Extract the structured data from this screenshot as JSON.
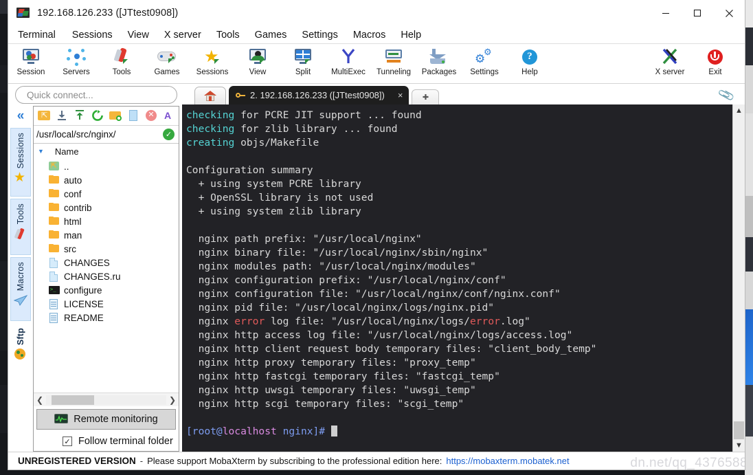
{
  "window": {
    "title": "192.168.126.233 ([JTtest0908])",
    "app_icon": "mobaxterm-icon",
    "controls": {
      "minimize": "minimize-icon",
      "maximize": "maximize-icon",
      "close": "close-icon"
    }
  },
  "menubar": {
    "items": [
      {
        "label": "Terminal"
      },
      {
        "label": "Sessions"
      },
      {
        "label": "View"
      },
      {
        "label": "X server"
      },
      {
        "label": "Tools"
      },
      {
        "label": "Games"
      },
      {
        "label": "Settings"
      },
      {
        "label": "Macros"
      },
      {
        "label": "Help"
      }
    ]
  },
  "toolbar": {
    "left_items": [
      {
        "label": "Session",
        "icon": "session-icon"
      },
      {
        "label": "Servers",
        "icon": "servers-icon"
      },
      {
        "label": "Tools",
        "icon": "tools-icon"
      },
      {
        "label": "Games",
        "icon": "games-icon"
      },
      {
        "label": "Sessions",
        "icon": "sessions-star-icon"
      },
      {
        "label": "View",
        "icon": "view-icon"
      },
      {
        "label": "Split",
        "icon": "split-icon"
      },
      {
        "label": "MultiExec",
        "icon": "multiexec-icon"
      },
      {
        "label": "Tunneling",
        "icon": "tunneling-icon"
      },
      {
        "label": "Packages",
        "icon": "packages-icon"
      },
      {
        "label": "Settings",
        "icon": "settings-gear-icon"
      },
      {
        "label": "Help",
        "icon": "help-icon"
      }
    ],
    "right_items": [
      {
        "label": "X server",
        "icon": "x-server-icon"
      },
      {
        "label": "Exit",
        "icon": "exit-power-icon"
      }
    ]
  },
  "sidebar": {
    "quick_connect_placeholder": "Quick connect...",
    "collapse_icon": "double-chevron-left-icon",
    "rail_tabs": [
      {
        "label": "Sessions",
        "icon": "star-icon",
        "selected": false
      },
      {
        "label": "Tools",
        "icon": "knife-icon",
        "selected": false
      },
      {
        "label": "Macros",
        "icon": "paperplane-icon",
        "selected": false
      },
      {
        "label": "Sftp",
        "icon": "globe-icon",
        "selected": true
      }
    ],
    "sftp_toolbar_icons": [
      "go-up-icon",
      "download-icon",
      "upload-icon",
      "refresh-icon",
      "new-folder-icon",
      "new-file-icon",
      "delete-icon",
      "edit-icon"
    ],
    "path": "/usr/local/src/nginx/",
    "path_ok_icon": "check-circle-icon",
    "column_header": "Name",
    "sort_caret_icon": "caret-down-icon",
    "files": [
      {
        "name": "..",
        "type": "parent"
      },
      {
        "name": "auto",
        "type": "folder"
      },
      {
        "name": "conf",
        "type": "folder"
      },
      {
        "name": "contrib",
        "type": "folder"
      },
      {
        "name": "html",
        "type": "folder"
      },
      {
        "name": "man",
        "type": "folder"
      },
      {
        "name": "src",
        "type": "folder"
      },
      {
        "name": "CHANGES",
        "type": "file"
      },
      {
        "name": "CHANGES.ru",
        "type": "file"
      },
      {
        "name": "configure",
        "type": "script"
      },
      {
        "name": "LICENSE",
        "type": "doc"
      },
      {
        "name": "README",
        "type": "doc"
      }
    ],
    "hscroll": {
      "left_arrow": "chevron-left-icon",
      "right_arrow": "chevron-right-icon"
    },
    "remote_monitoring_label": "Remote monitoring",
    "remote_monitoring_icon": "monitor-graph-icon",
    "follow_terminal_folder_label": "Follow terminal folder",
    "follow_terminal_folder_checked": true,
    "checkmark": "✓"
  },
  "tabs": {
    "home_icon": "home-icon",
    "terminal_tab": {
      "icon": "key-icon",
      "label": "2. 192.168.126.233 ([JTtest0908])",
      "close": "×"
    },
    "add_tab_label": "✚",
    "clip_icon": "paperclip-icon"
  },
  "terminal": {
    "prompt_user": "[root@",
    "prompt_host": "localhost",
    "prompt_path": " nginx]#",
    "lines": [
      {
        "segments": [
          {
            "t": "checking",
            "c": "cy"
          },
          {
            "t": " for PCRE JIT support ... found",
            "c": ""
          }
        ]
      },
      {
        "segments": [
          {
            "t": "checking",
            "c": "cy"
          },
          {
            "t": " for zlib library ... found",
            "c": ""
          }
        ]
      },
      {
        "segments": [
          {
            "t": "creating",
            "c": "cy"
          },
          {
            "t": " objs/Makefile",
            "c": ""
          }
        ]
      },
      {
        "segments": [
          {
            "t": "",
            "c": ""
          }
        ]
      },
      {
        "segments": [
          {
            "t": "Configuration summary",
            "c": ""
          }
        ]
      },
      {
        "segments": [
          {
            "t": "  + using system PCRE library",
            "c": ""
          }
        ]
      },
      {
        "segments": [
          {
            "t": "  + OpenSSL library is not used",
            "c": ""
          }
        ]
      },
      {
        "segments": [
          {
            "t": "  + using system zlib library",
            "c": ""
          }
        ]
      },
      {
        "segments": [
          {
            "t": "",
            "c": ""
          }
        ]
      },
      {
        "segments": [
          {
            "t": "  nginx path prefix: \"/usr/local/nginx\"",
            "c": ""
          }
        ]
      },
      {
        "segments": [
          {
            "t": "  nginx binary file: \"/usr/local/nginx/sbin/nginx\"",
            "c": ""
          }
        ]
      },
      {
        "segments": [
          {
            "t": "  nginx modules path: \"/usr/local/nginx/modules\"",
            "c": ""
          }
        ]
      },
      {
        "segments": [
          {
            "t": "  nginx configuration prefix: \"/usr/local/nginx/conf\"",
            "c": ""
          }
        ]
      },
      {
        "segments": [
          {
            "t": "  nginx configuration file: \"/usr/local/nginx/conf/nginx.conf\"",
            "c": ""
          }
        ]
      },
      {
        "segments": [
          {
            "t": "  nginx pid file: \"/usr/local/nginx/logs/nginx.pid\"",
            "c": ""
          }
        ]
      },
      {
        "segments": [
          {
            "t": "  nginx ",
            "c": ""
          },
          {
            "t": "error",
            "c": "rd"
          },
          {
            "t": " log file: \"/usr/local/nginx/logs/",
            "c": ""
          },
          {
            "t": "error",
            "c": "rd"
          },
          {
            "t": ".log\"",
            "c": ""
          }
        ]
      },
      {
        "segments": [
          {
            "t": "  nginx http access log file: \"/usr/local/nginx/logs/access.log\"",
            "c": ""
          }
        ]
      },
      {
        "segments": [
          {
            "t": "  nginx http client request body temporary files: \"client_body_temp\"",
            "c": ""
          }
        ]
      },
      {
        "segments": [
          {
            "t": "  nginx http proxy temporary files: \"proxy_temp\"",
            "c": ""
          }
        ]
      },
      {
        "segments": [
          {
            "t": "  nginx http fastcgi temporary files: \"fastcgi_temp\"",
            "c": ""
          }
        ]
      },
      {
        "segments": [
          {
            "t": "  nginx http uwsgi temporary files: \"uwsgi_temp\"",
            "c": ""
          }
        ]
      },
      {
        "segments": [
          {
            "t": "  nginx http scgi temporary files: \"scgi_temp\"",
            "c": ""
          }
        ]
      },
      {
        "segments": [
          {
            "t": "",
            "c": ""
          }
        ]
      }
    ],
    "scrollbar": {
      "up": "chevron-up-icon",
      "down": "chevron-down-icon"
    }
  },
  "statusbar": {
    "unregistered": "UNREGISTERED VERSION",
    "dash": "-",
    "message": "Please support MobaXterm by subscribing to the professional edition here:",
    "link": "https://mobaxterm.mobatek.net",
    "watermark": "dn.net/qq_4376588"
  },
  "colors": {
    "accent_blue": "#2f7fd6",
    "terminal_bg": "#222226",
    "terminal_fg": "#d8d8d8",
    "cyan": "#55d4d4",
    "red": "#e05a5a",
    "magenta": "#d98ae0"
  }
}
